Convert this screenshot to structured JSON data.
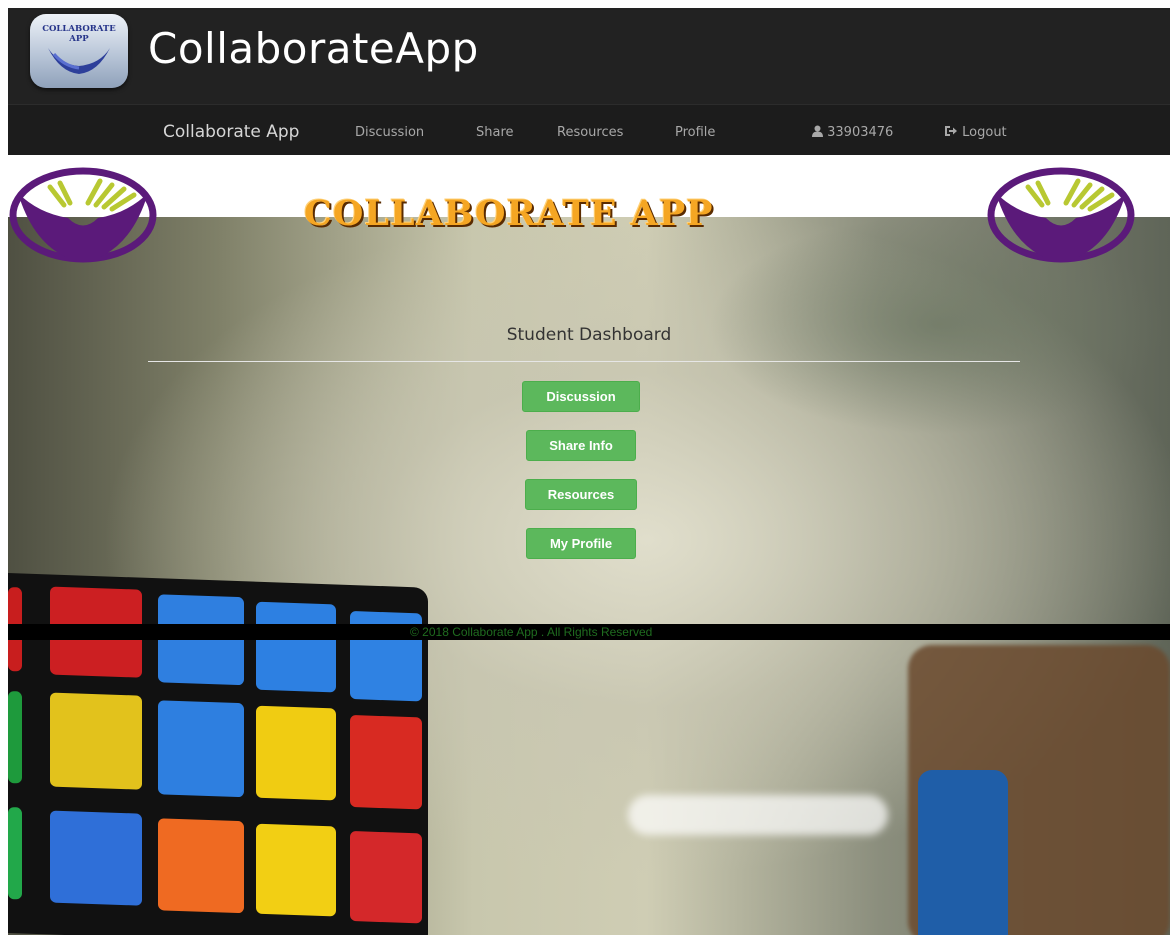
{
  "window": {
    "title": "CollaborateApp",
    "icon_text": [
      "COLLABORATE",
      "APP"
    ]
  },
  "navbar": {
    "brand": "Collaborate App",
    "links": [
      "Discussion",
      "Share",
      "Resources",
      "Profile"
    ],
    "user_id": "33903476",
    "logout": "Logout",
    "user_icon": "user-icon",
    "logout_icon": "sign-out-icon"
  },
  "banner": {
    "text": "COLLABORATE APP"
  },
  "dashboard": {
    "title": "Student Dashboard",
    "buttons": [
      "Discussion",
      "Share Info",
      "Resources",
      "My Profile"
    ]
  },
  "footer": {
    "text": "© 2018 Collaborate App . All Rights Reserved"
  },
  "colors": {
    "button": "#5cb85c",
    "navbar": "#1c1c1c",
    "banner": "#f5a623",
    "logo_purple": "#5b1a7a",
    "logo_green": "#b8c832"
  }
}
